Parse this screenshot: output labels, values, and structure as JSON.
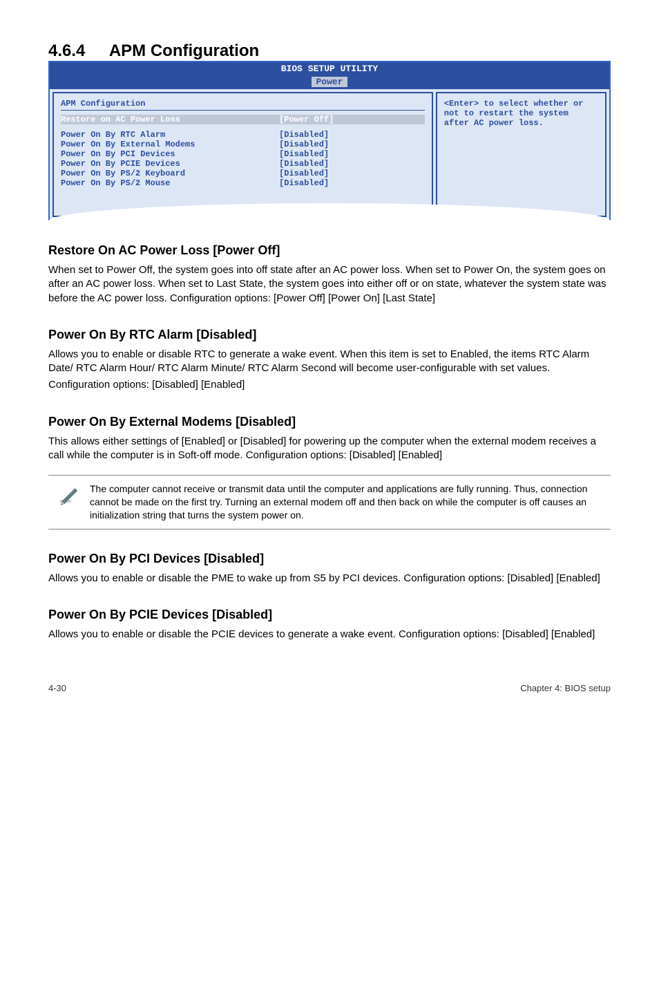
{
  "section": {
    "number": "4.6.4",
    "title": "APM Configuration"
  },
  "bios": {
    "header": "BIOS SETUP UTILITY",
    "tab": "Power",
    "panel_title": "APM Configuration",
    "rows": [
      {
        "label": "Restore on AC Power Loss",
        "value": "[Power Off]",
        "highlight": true
      },
      {
        "label": "Power On By RTC Alarm",
        "value": "[Disabled]"
      },
      {
        "label": "Power On By External Modems",
        "value": "[Disabled]"
      },
      {
        "label": "Power On By PCI Devices",
        "value": "[Disabled]"
      },
      {
        "label": "Power On By PCIE Devices",
        "value": "[Disabled]"
      },
      {
        "label": "Power On By PS/2 Keyboard",
        "value": "[Disabled]"
      },
      {
        "label": "Power On By PS/2 Mouse",
        "value": "[Disabled]"
      }
    ],
    "help": "<Enter> to select whether or not to restart the system after AC power loss."
  },
  "sections": {
    "s1": {
      "h": "Restore On AC Power Loss [Power Off]",
      "p": "When set to Power Off, the system goes into off state after an AC power loss. When set to Power On, the system goes on after an AC power loss. When set to Last State, the system goes into either off or on state, whatever the system state was before the AC power loss. Configuration options: [Power Off] [Power On] [Last State]"
    },
    "s2": {
      "h": "Power On By RTC Alarm [Disabled]",
      "p1": "Allows you to enable or disable RTC to generate a wake event. When this item is set to Enabled, the items RTC Alarm Date/ RTC Alarm Hour/ RTC Alarm Minute/ RTC Alarm Second will become user-configurable with set values.",
      "p2": "Configuration options: [Disabled] [Enabled]"
    },
    "s3": {
      "h": "Power On By External Modems [Disabled]",
      "p": "This allows either settings of [Enabled] or [Disabled] for powering up the computer when the external modem receives a call while the computer is in Soft-off mode. Configuration options: [Disabled] [Enabled]"
    },
    "note": "The computer cannot receive or transmit data until the computer and applications are fully running. Thus, connection cannot be made on the first try. Turning an external modem off and then back on while the computer is off causes an initialization string that turns the system power on.",
    "s4": {
      "h": "Power On By PCI Devices [Disabled]",
      "p": "Allows you to enable or disable the PME to wake up from S5 by PCI devices. Configuration options: [Disabled] [Enabled]"
    },
    "s5": {
      "h": "Power On By PCIE Devices [Disabled]",
      "p": "Allows you to enable or disable the PCIE devices to generate a wake event. Configuration options: [Disabled] [Enabled]"
    }
  },
  "footer": {
    "left": "4-30",
    "right": "Chapter 4: BIOS setup"
  }
}
